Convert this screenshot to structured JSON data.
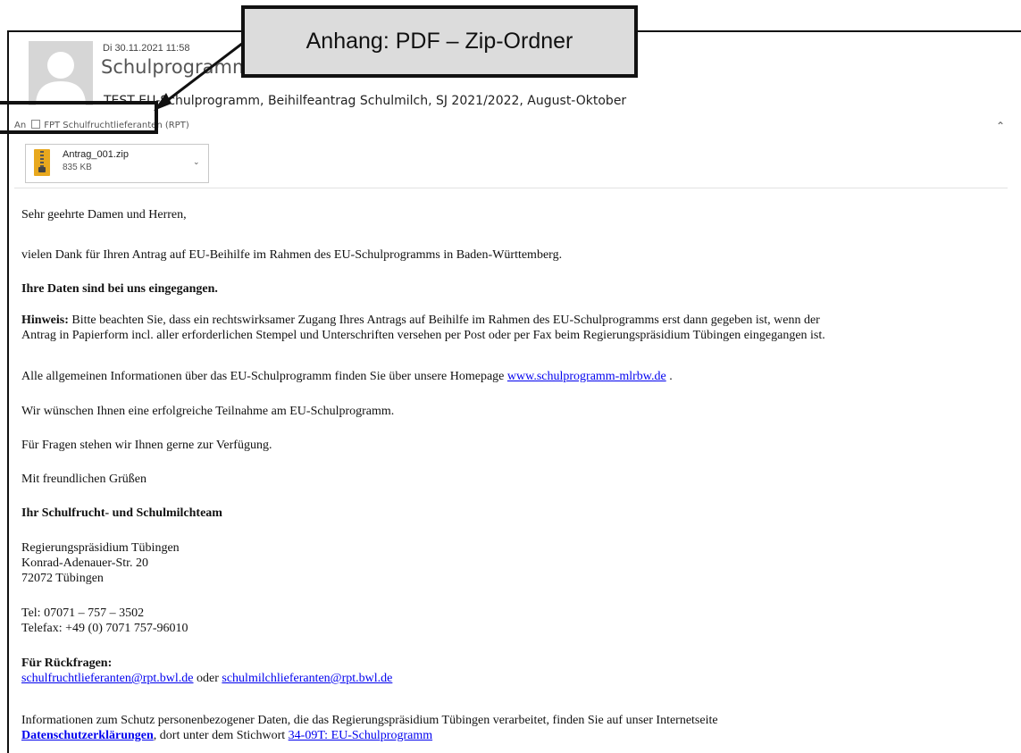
{
  "header": {
    "date": "Di 30.11.2021 11:58",
    "sender": "Schulprogramm-Lieferanten (MLR)",
    "subject": "TEST EU-Schulprogramm, Beihilfeantrag Schulmilch, SJ 2021/2022, August-Oktober",
    "to_label": "An",
    "to_recipient": "FPT Schulfruchtlieferanten (RPT)",
    "collapse_icon": "chevron-up-icon"
  },
  "attachment": {
    "name": "Antrag_001.zip",
    "size": "835 KB",
    "icon": "zip-folder-icon",
    "dropdown_icon": "chevron-down-icon"
  },
  "callout": {
    "text": "Anhang: PDF – Zip-Ordner"
  },
  "body": {
    "greeting": "Sehr geehrte Damen und Herren,",
    "thanks": "vielen Dank für Ihren Antrag auf EU-Beihilfe im Rahmen des EU-Schulprogramms in Baden-Württemberg.",
    "received": "Ihre Daten sind bei uns eingegangen.",
    "hint_label": "Hinweis:",
    "hint_line1": " Bitte beachten Sie, dass ein rechtswirksamer Zugang Ihres Antrags auf Beihilfe im Rahmen des EU-Schulprogramms erst dann gegeben ist, wenn der",
    "hint_line2": "Antrag in Papierform incl. aller erforderlichen Stempel und Unterschriften versehen per Post oder per Fax beim Regierungspräsidium Tübingen eingegangen ist.",
    "info_text": "Alle allgemeinen Informationen über das EU-Schulprogramm finden Sie über unsere Homepage ",
    "info_link": "www.schulprogramm-mlrbw.de",
    "info_end": " .",
    "wish": "Wir wünschen Ihnen eine erfolgreiche Teilnahme am EU-Schulprogramm.",
    "questions": "Für Fragen stehen wir Ihnen gerne zur Verfügung.",
    "regards": "Mit freundlichen Grüßen",
    "team": "Ihr Schulfrucht- und Schulmilchteam",
    "address1": "Regierungspräsidium Tübingen",
    "address2": "Konrad-Adenauer-Str. 20",
    "address3": "72072 Tübingen",
    "tel": "Tel: 07071 – 757 – 3502",
    "fax": "Telefax: +49 (0) 7071 757-96010",
    "contact_heading": "Für Rückfragen:",
    "email1": "schulfruchtlieferanten@rpt.bwl.de",
    "or": " oder ",
    "email2": "schulmilchlieferanten@rpt.bwl.de",
    "privacy_line1": "Informationen zum Schutz personenbezogener Daten, die das Regierungspräsidium Tübingen verarbeitet, finden Sie auf unser Internetseite",
    "privacy_link": "Datenschutzerklärungen",
    "privacy_mid": ", dort unter dem Stichwort ",
    "privacy_link2": "34-09T: EU-Schulprogramm"
  }
}
